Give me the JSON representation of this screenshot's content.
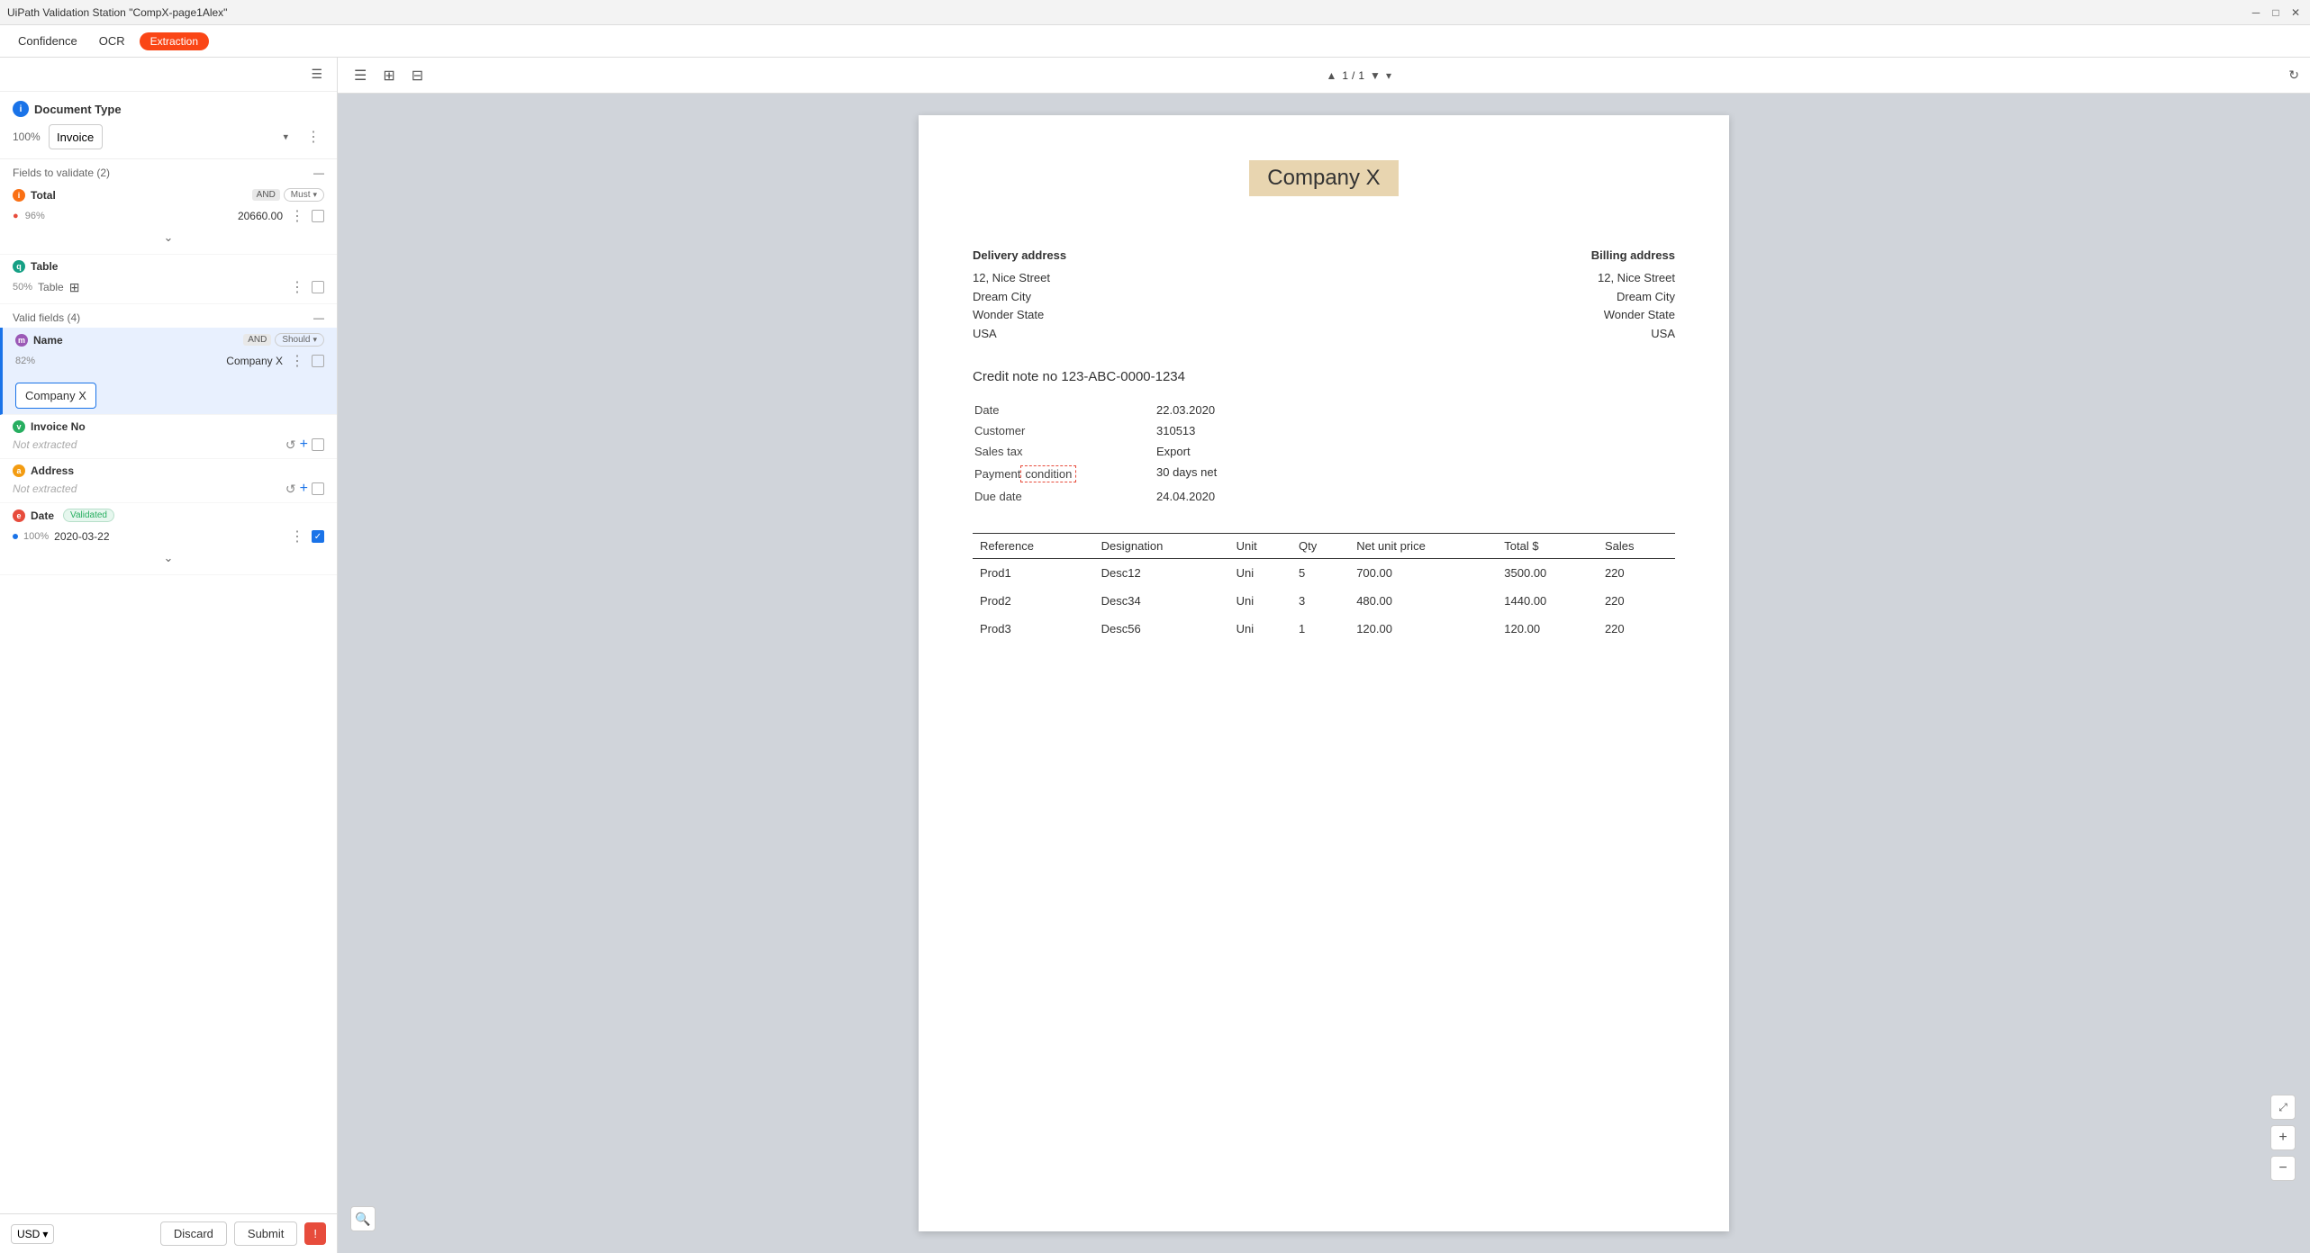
{
  "titlebar": {
    "title": "UiPath Validation Station \"CompX-page1Alex\"",
    "controls": [
      "minimize",
      "maximize",
      "close"
    ]
  },
  "tabs": {
    "confidence_label": "Confidence",
    "ocr_label": "OCR",
    "extraction_label": "Extraction"
  },
  "toolbar": {
    "filter_icon": "≡",
    "layout_icon": "⊞",
    "view_icon": "⊟"
  },
  "document_type": {
    "title": "Document Type",
    "confidence": "100%",
    "value": "Invoice",
    "menu_icon": "⋮"
  },
  "fields_validate": {
    "header": "Fields to validate (2)",
    "collapse_icon": "—"
  },
  "total_field": {
    "name": "Total",
    "and": "AND",
    "constraint": "Must",
    "confidence": "96%",
    "has_warning": true,
    "value": "20660.00",
    "expand_icon": "⌄"
  },
  "table_field": {
    "name": "Table",
    "confidence": "50%",
    "table_label": "Table",
    "grid_icon": "⊞"
  },
  "valid_fields": {
    "header": "Valid fields (4)",
    "collapse_icon": "—"
  },
  "name_field": {
    "name": "Name",
    "and": "AND",
    "constraint": "Should",
    "confidence": "82%",
    "value": "Company X",
    "preview": "Company X"
  },
  "invoice_no_field": {
    "name": "Invoice No",
    "value_display": "Not extracted"
  },
  "address_field": {
    "name": "Address",
    "value_display": "Not extracted"
  },
  "date_field": {
    "name": "Date",
    "validated_badge": "Validated",
    "confidence": "100%",
    "value": "2020-03-22"
  },
  "bottom_bar": {
    "currency": "USD",
    "discard_label": "Discard",
    "submit_label": "Submit",
    "reject_label": "!"
  },
  "viewer": {
    "page_current": "1",
    "page_total": "1",
    "refresh_icon": "↻"
  },
  "document": {
    "company_name": "Company X",
    "delivery_address_title": "Delivery address",
    "billing_address_title": "Billing address",
    "delivery_street": "12, Nice Street",
    "delivery_city": "Dream City",
    "delivery_state": "Wonder State",
    "delivery_country": "USA",
    "billing_street": "12, Nice Street",
    "billing_city": "Dream City",
    "billing_state": "Wonder State",
    "billing_country": "USA",
    "credit_note_title": "Credit note no 123-ABC-0000-1234",
    "date_label": "Date",
    "date_value": "22.03.2020",
    "customer_label": "Customer",
    "customer_value": "310513",
    "sales_tax_label": "Sales tax",
    "sales_tax_value": "Export",
    "payment_label": "Payment condition",
    "payment_value": "30 days net",
    "due_date_label": "Due date",
    "due_date_value": "24.04.2020",
    "table_headers": [
      "Reference",
      "Designation",
      "Unit",
      "Qty",
      "Net unit price",
      "Total $",
      "Sales"
    ],
    "table_rows": [
      [
        "Prod1",
        "Desc12",
        "Uni",
        "5",
        "700.00",
        "3500.00",
        "220"
      ],
      [
        "Prod2",
        "Desc34",
        "Uni",
        "3",
        "480.00",
        "1440.00",
        "220"
      ],
      [
        "Prod3",
        "Desc56",
        "Uni",
        "1",
        "120.00",
        "120.00",
        "220"
      ]
    ]
  }
}
